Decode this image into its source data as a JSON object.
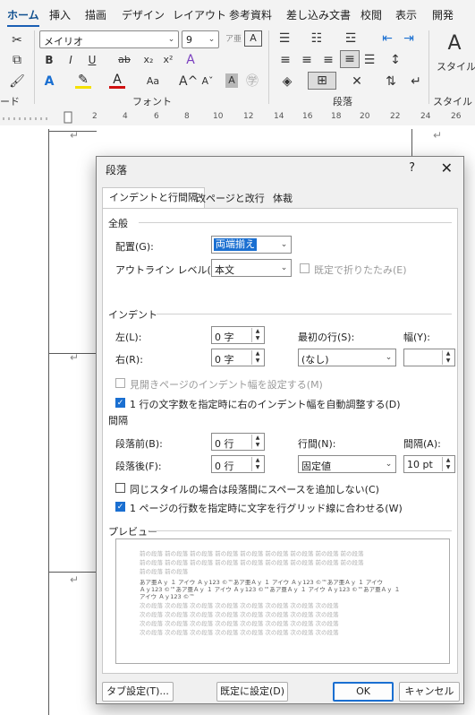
{
  "ribbon": {
    "tabs": [
      "ホーム",
      "挿入",
      "描画",
      "デザイン",
      "レイアウト",
      "参考資料",
      "差し込み文書",
      "校閲",
      "表示",
      "開発"
    ],
    "font_name": "メイリオ",
    "font_size": "9",
    "group_font": "フォント",
    "group_paragraph": "段落",
    "group_style_partial": "スタイル",
    "group_clipboard_partial": "ード",
    "style_button_partial": "スタイル",
    "ruler_marks": [
      "2",
      "4",
      "6",
      "8",
      "10",
      "12",
      "14",
      "16",
      "18",
      "20",
      "22",
      "24",
      "26"
    ]
  },
  "dialog": {
    "title": "段落",
    "help": "?",
    "close": "✕",
    "tabs": [
      "インデントと行間隔",
      "改ページと改行",
      "体裁"
    ],
    "general": {
      "header": "全般",
      "alignment_label": "配置(G):",
      "alignment_value": "両端揃え",
      "outline_label": "アウトライン レベル(O):",
      "outline_value": "本文",
      "collapsed_label": "既定で折りたたみ(E)"
    },
    "indent": {
      "header": "インデント",
      "left_label": "左(L):",
      "left_value": "0 字",
      "right_label": "右(R):",
      "right_value": "0 字",
      "first_line_label": "最初の行(S):",
      "first_line_value": "(なし)",
      "width_label": "幅(Y):",
      "width_value": "",
      "mirror_label": "見開きページのインデント幅を設定する(M)",
      "auto_adjust_label": "1 行の文字数を指定時に右のインデント幅を自動調整する(D)"
    },
    "spacing": {
      "header": "間隔",
      "before_label": "段落前(B):",
      "before_value": "0 行",
      "after_label": "段落後(F):",
      "after_value": "0 行",
      "line_label": "行間(N):",
      "line_value": "固定値",
      "at_label": "間隔(A):",
      "at_value": "10 pt",
      "no_space_label": "同じスタイルの場合は段落間にスペースを追加しない(C)",
      "snap_grid_label": "1 ページの行数を指定時に文字を行グリッド線に合わせる(W)"
    },
    "preview": {
      "header": "プレビュー",
      "prev_lines": [
        "前の段落 前の段落 前の段落 前の段落 前の段落 前の段落 前の段落 前の段落 前の段落",
        "前の段落 前の段落 前の段落 前の段落 前の段落 前の段落 前の段落 前の段落 前の段落",
        "前の段落 前の段落"
      ],
      "sample_lines": [
        "あア亜Ａｙ １ アイウ Ａｙ123 ©™あア亜Ａｙ １ アイウ Ａｙ123 ©™あア亜Ａｙ １ アイウ",
        "Ａｙ123 ©™あア亜Ａｙ １ アイウ Ａｙ123 ©™あア亜Ａｙ １ アイウ Ａｙ123 ©™あア亜Ａｙ １",
        "アイウ Ａｙ123 ©™"
      ],
      "next_lines": [
        "次の段落 次の段落 次の段落 次の段落 次の段落 次の段落 次の段落 次の段落",
        "次の段落 次の段落 次の段落 次の段落 次の段落 次の段落 次の段落 次の段落",
        "次の段落 次の段落 次の段落 次の段落 次の段落 次の段落 次の段落 次の段落",
        "次の段落 次の段落 次の段落 次の段落 次の段落 次の段落 次の段落 次の段落"
      ]
    },
    "buttons": {
      "tabs": "タブ設定(T)...",
      "default": "既定に設定(D)",
      "ok": "OK",
      "cancel": "キャンセル"
    }
  },
  "colors": {
    "accent": "#1a6fd1",
    "dialog_bg": "#f0f0f0",
    "ribbon_bg": "#f3f3f3"
  }
}
